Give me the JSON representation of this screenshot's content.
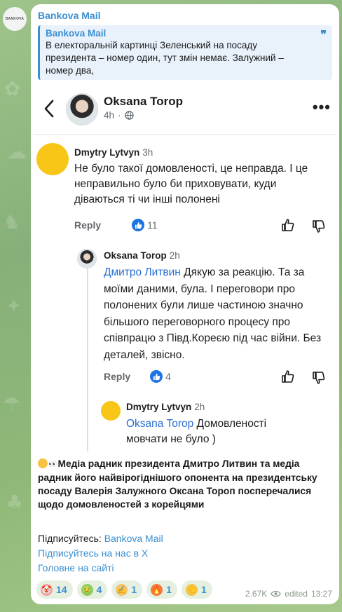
{
  "channel": {
    "name": "Bankova Mail",
    "avatar_text": "BANKOVA"
  },
  "quote": {
    "title": "Bankova Mail",
    "text": "В електоральній картинці Зеленський на посаду президента – номер один, тут змін немає. Залужний – номер два,"
  },
  "post": {
    "author": "Oksana Torop",
    "time": "4h",
    "comments": [
      {
        "author": "Dmytry Lytvyn",
        "time": "3h",
        "text": "Не було такої домовленості, це неправда. І це неправильно було би приховувати, куди діваються ті чи інші полонені",
        "reply_label": "Reply",
        "likes": "11"
      },
      {
        "author": "Oksana Torop",
        "time": "2h",
        "mention": "Дмитро Литвин",
        "text": "Дякую за реакцію. Та за моїми даними, була. І переговори про полонених були лише частиною значно більшого переговорного процесу про співпрацю з Півд.Кореєю під час війни. Без деталей, звісно.",
        "reply_label": "Reply",
        "likes": "4"
      },
      {
        "author": "Dmytry Lytvyn",
        "time": "2h",
        "mention": "Oksana Torop",
        "text": "Домовленості мовчати не було )"
      }
    ]
  },
  "message": {
    "body": "Медіа радник президента Дмитро Литвин та медіа радник його найвірогіднішого опонента на президентську посаду Валерія Залужного Оксана Тороп посперечалися щодо домовленостей з корейцями",
    "subscribe_label": "Підписуйтесь: ",
    "subscribe_link": "Bankova Mail",
    "x_link": "Підписуйтесь на нас в X",
    "site_link": "Головне на сайті"
  },
  "reactions": [
    {
      "icon": "clown-face-icon",
      "count": "14",
      "bg": "#f4a3a3"
    },
    {
      "icon": "nauseated-face-icon",
      "count": "4",
      "bg": "#8ccf5a"
    },
    {
      "icon": "writing-hand-icon",
      "count": "1",
      "bg": "#f2c46b"
    },
    {
      "icon": "fire-icon",
      "count": "1",
      "bg": "#f4793b"
    },
    {
      "icon": "pointing-hand-icon",
      "count": "1",
      "bg": "#f6c343"
    }
  ],
  "footer": {
    "views": "2.67K",
    "edited_label": "edited",
    "time": "13:27"
  },
  "colors": {
    "accent": "#3a8fd1",
    "fb_blue": "#1b74e4",
    "mention": "#2a6fd1"
  }
}
